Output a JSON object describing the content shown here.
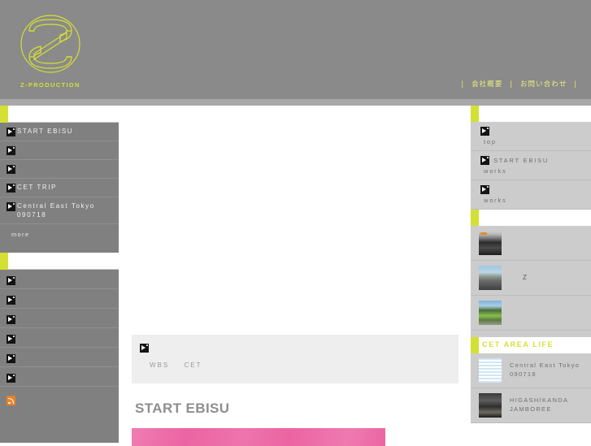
{
  "header": {
    "logo_wordmark": "Z-PRODUCTION",
    "logo_icon": "z-production-logo",
    "nav": [
      {
        "label": "会社概要"
      },
      {
        "label": "お問い合わせ"
      }
    ],
    "separator": "|"
  },
  "colors": {
    "accent_yellow": "#d5e034",
    "header_gray": "#8a8a8a",
    "left_sidebar_gray": "#808080",
    "right_sidebar_gray": "#cccccc",
    "hero_pink": "#ec64a3",
    "rss_orange": "#e8822a",
    "title_gray": "#8e8e8e"
  },
  "left_sidebar": {
    "panel1": {
      "header_label": "",
      "items": [
        {
          "label": "START EBISU",
          "icon": "broken-image-icon"
        },
        {
          "label": "",
          "icon": "broken-image-icon"
        },
        {
          "label": "",
          "icon": "broken-image-icon"
        },
        {
          "label": "CET TRIP",
          "icon": "broken-image-icon"
        },
        {
          "label": "Central East Tokyo 090718",
          "icon": "broken-image-icon"
        }
      ],
      "more_label": "more"
    },
    "panel2": {
      "header_label": "",
      "items": [
        {
          "label": "",
          "icon": "broken-image-icon"
        },
        {
          "label": "",
          "icon": "broken-image-icon"
        },
        {
          "label": "",
          "icon": "broken-image-icon"
        },
        {
          "label": "",
          "icon": "broken-image-icon"
        },
        {
          "label": "",
          "icon": "broken-image-icon"
        },
        {
          "label": "",
          "icon": "broken-image-icon"
        }
      ],
      "feed_icon": "rss-icon"
    }
  },
  "main": {
    "tag_box": {
      "icon": "broken-image-icon",
      "tags": [
        "WBS",
        "CET"
      ]
    },
    "title": "START EBISU",
    "hero_image": "pink-banner-image"
  },
  "right_sidebar": {
    "panel1": {
      "header_label": "",
      "items": [
        {
          "title": "",
          "sub": "top",
          "icon": "broken-image-icon"
        },
        {
          "title": "START EBISU",
          "sub": "works",
          "icon": "broken-image-icon"
        },
        {
          "title": "",
          "sub": "works",
          "icon": "broken-image-icon"
        }
      ]
    },
    "panel2": {
      "header_label": "",
      "items": [
        {
          "thumb": "car-dashboard-thumb",
          "caption": ""
        },
        {
          "thumb": "car-street-thumb",
          "caption": "Z"
        },
        {
          "thumb": "green-car-landscape-thumb",
          "caption": ""
        }
      ]
    },
    "panel3": {
      "header_label": "CET AREA LIFE",
      "items": [
        {
          "thumb": "blue-map-thumb",
          "caption": "Central East Tokyo 090718"
        },
        {
          "thumb": "night-event-thumb",
          "caption": "HIGASHIKANDA JAMBOREE"
        }
      ]
    }
  }
}
